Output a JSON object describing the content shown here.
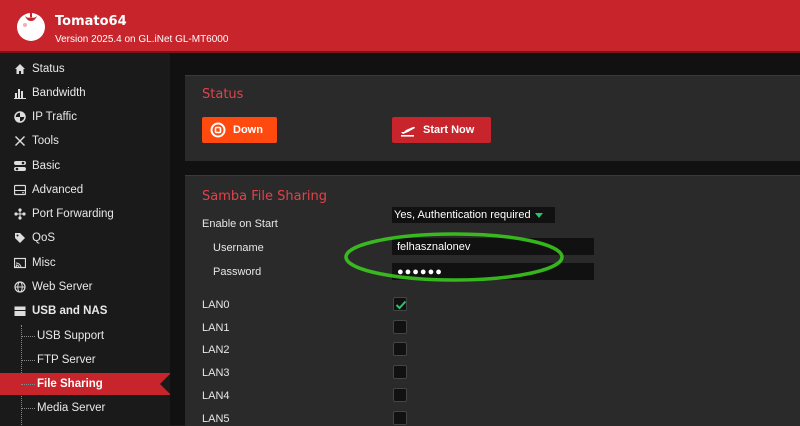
{
  "header": {
    "title": "Tomato64",
    "subtitle": "Version 2025.4 on GL.iNet GL-MT6000"
  },
  "sidebar": {
    "items": [
      {
        "label": "Status",
        "icon": "home-icon"
      },
      {
        "label": "Bandwidth",
        "icon": "bar-chart-icon"
      },
      {
        "label": "IP Traffic",
        "icon": "pie-icon"
      },
      {
        "label": "Tools",
        "icon": "tools-icon"
      },
      {
        "label": "Basic",
        "icon": "toggles-icon"
      },
      {
        "label": "Advanced",
        "icon": "hdd-icon"
      },
      {
        "label": "Port Forwarding",
        "icon": "network-icon"
      },
      {
        "label": "QoS",
        "icon": "tag-icon"
      },
      {
        "label": "Misc",
        "icon": "cast-icon"
      },
      {
        "label": "Web Server",
        "icon": "globe-icon"
      },
      {
        "label": "USB and NAS",
        "icon": "folder-icon"
      }
    ],
    "subitems": [
      {
        "label": "USB Support"
      },
      {
        "label": "FTP Server"
      },
      {
        "label": "File Sharing"
      },
      {
        "label": "Media Server"
      }
    ]
  },
  "status_panel": {
    "title": "Status",
    "down_label": "Down",
    "start_label": "Start Now"
  },
  "samba_panel": {
    "title": "Samba File Sharing",
    "enable_label": "Enable on Start",
    "enable_value": "Yes, Authentication required",
    "username_label": "Username",
    "username_value": "felhasznalonev",
    "password_label": "Password",
    "password_value": "●●●●●●",
    "lans": [
      {
        "label": "LAN0",
        "checked": true
      },
      {
        "label": "LAN1",
        "checked": false
      },
      {
        "label": "LAN2",
        "checked": false
      },
      {
        "label": "LAN3",
        "checked": false
      },
      {
        "label": "LAN4",
        "checked": false
      },
      {
        "label": "LAN5",
        "checked": false
      }
    ]
  },
  "colors": {
    "brand": "#c8242b",
    "accent_orange": "#ff4a0f",
    "title_red": "#e2424a",
    "check_green": "#27c46a",
    "highlight_green": "#3cd11f"
  }
}
